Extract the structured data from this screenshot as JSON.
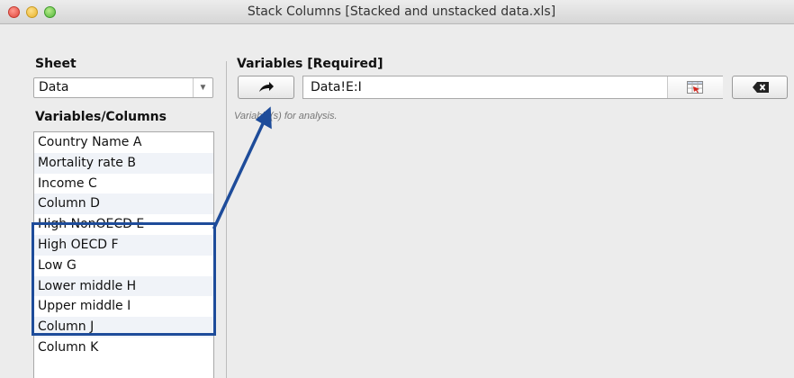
{
  "window": {
    "title": "Stack Columns [Stacked and unstacked data.xls]"
  },
  "sheet": {
    "label": "Sheet",
    "value": "Data"
  },
  "variables_columns": {
    "label": "Variables/Columns",
    "items": [
      "Country Name A",
      "Mortality rate B",
      "Income C",
      "Column D",
      "High NonOECD E",
      "High OECD F",
      "Low G",
      "Lower middle H",
      "Upper middle I",
      "Column J",
      "Column K"
    ],
    "highlighted_items": [
      "High NonOECD E",
      "High OECD F",
      "Low G",
      "Lower middle H",
      "Upper middle I"
    ]
  },
  "variables": {
    "label": "Variables [Required]",
    "add_button_icon": "arrow-right-icon",
    "range_value": "Data!E:I",
    "range_picker_icon": "range-select-icon",
    "clear_button_icon": "delete-backspace-icon",
    "hint": "Variable(s) for analysis."
  },
  "colors": {
    "annotation": "#1e4c9a",
    "alt_row": "#f0f3f8"
  }
}
